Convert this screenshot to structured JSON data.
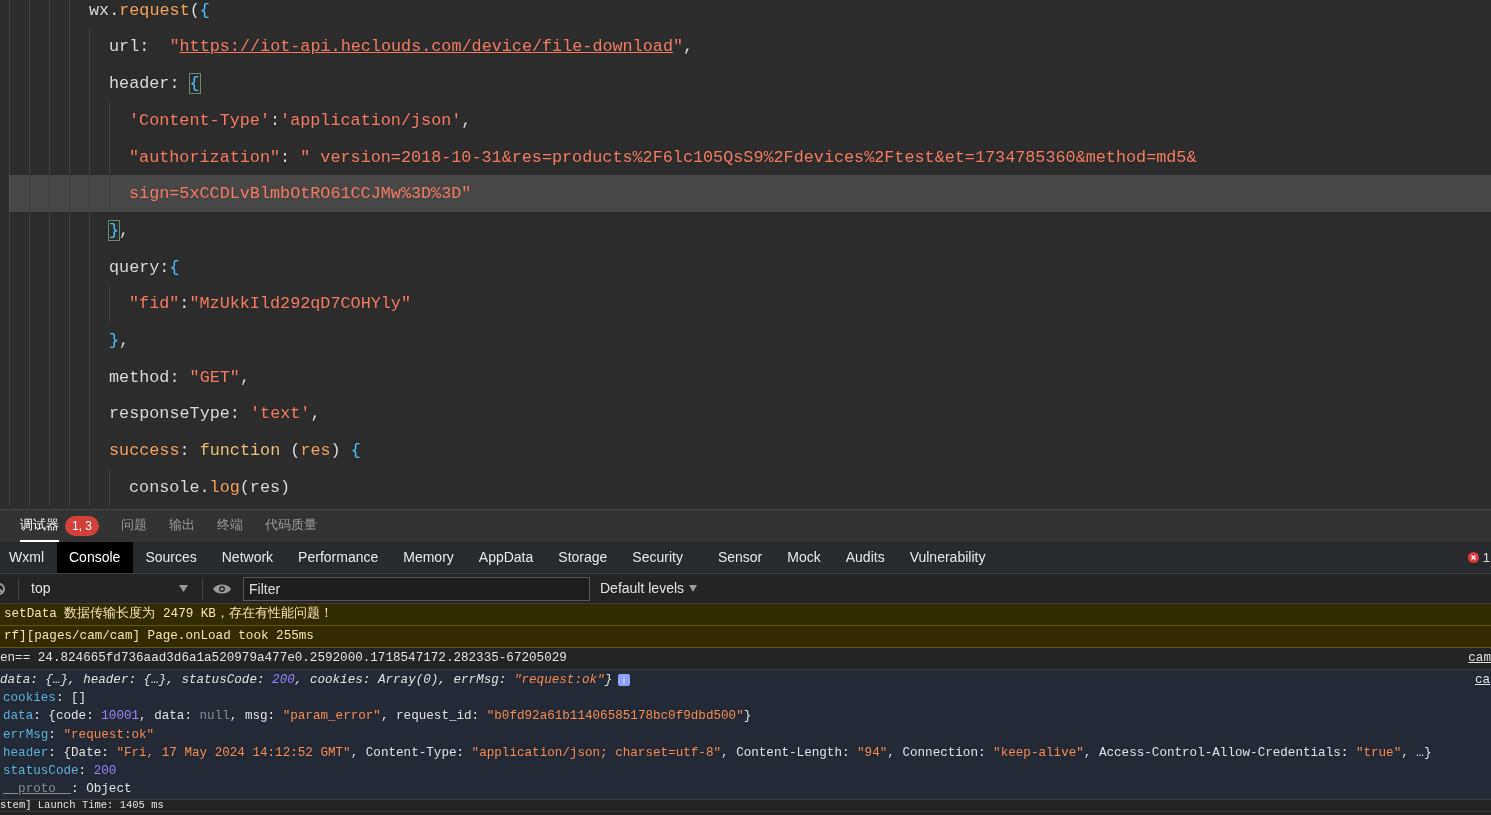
{
  "editor": {
    "lines": [
      {
        "highlighted": false,
        "tokens": [
          {
            "t": "wx.",
            "kind": "plain"
          },
          {
            "t": "request",
            "kind": "func"
          },
          {
            "t": "(",
            "kind": "plain"
          },
          {
            "t": "{",
            "kind": "bracket"
          }
        ],
        "children": [
          {
            "highlighted": false,
            "tokens": [
              {
                "t": "url:  ",
                "kind": "plain"
              },
              {
                "t": "\"",
                "kind": "str"
              },
              {
                "t": "https://iot-api.heclouds.com/device/file-download",
                "kind": "link"
              },
              {
                "t": "\"",
                "kind": "str"
              },
              {
                "t": ",",
                "kind": "plain"
              }
            ]
          },
          {
            "highlighted": false,
            "tokens": [
              {
                "t": "header: ",
                "kind": "plain"
              },
              {
                "t": "{",
                "kind": "match"
              }
            ],
            "children": [
              {
                "highlighted": false,
                "tokens": [
                  {
                    "t": "'Content-Type'",
                    "kind": "str"
                  },
                  {
                    "t": ":",
                    "kind": "plain"
                  },
                  {
                    "t": "'application/json'",
                    "kind": "str"
                  },
                  {
                    "t": ",",
                    "kind": "plain"
                  }
                ]
              },
              {
                "highlighted": false,
                "tokens": [
                  {
                    "t": "\"authorization\"",
                    "kind": "str"
                  },
                  {
                    "t": ": ",
                    "kind": "plain"
                  },
                  {
                    "t": "\" version=2018-10-31&res=products%2F6lc105QsS9%2Fdevices%2Ftest&et=1734785360&method=md5&",
                    "kind": "str"
                  }
                ]
              },
              {
                "highlighted": true,
                "tokens": [
                  {
                    "t": "sign=5xCCDLvBlmbOtRO61CCJMw%3D%3D\"",
                    "kind": "str"
                  }
                ]
              }
            ]
          },
          {
            "highlighted": false,
            "tokens": [
              {
                "t": "}",
                "kind": "match"
              },
              {
                "t": ",",
                "kind": "plain"
              }
            ]
          },
          {
            "highlighted": false,
            "tokens": [
              {
                "t": "query:",
                "kind": "plain"
              },
              {
                "t": "{",
                "kind": "bracket"
              }
            ],
            "children": [
              {
                "highlighted": false,
                "tokens": [
                  {
                    "t": "\"fid\"",
                    "kind": "str"
                  },
                  {
                    "t": ":",
                    "kind": "plain"
                  },
                  {
                    "t": "\"MzUkkIld292qD7COHYly\"",
                    "kind": "str"
                  }
                ]
              }
            ]
          },
          {
            "highlighted": false,
            "tokens": [
              {
                "t": "}",
                "kind": "bracket"
              },
              {
                "t": ",",
                "kind": "plain"
              }
            ]
          },
          {
            "highlighted": false,
            "tokens": [
              {
                "t": "method: ",
                "kind": "plain"
              },
              {
                "t": "\"GET\"",
                "kind": "str"
              },
              {
                "t": ",",
                "kind": "plain"
              }
            ]
          },
          {
            "highlighted": false,
            "tokens": [
              {
                "t": "responseType: ",
                "kind": "plain"
              },
              {
                "t": "'text'",
                "kind": "str"
              },
              {
                "t": ",",
                "kind": "plain"
              }
            ]
          },
          {
            "highlighted": false,
            "tokens": [
              {
                "t": "success",
                "kind": "func"
              },
              {
                "t": ": ",
                "kind": "plain"
              },
              {
                "t": "function",
                "kind": "keyword"
              },
              {
                "t": " (",
                "kind": "plain"
              },
              {
                "t": "res",
                "kind": "param"
              },
              {
                "t": ") ",
                "kind": "plain"
              },
              {
                "t": "{",
                "kind": "bracket"
              }
            ],
            "children": [
              {
                "highlighted": false,
                "tokens": [
                  {
                    "t": "console.",
                    "kind": "plain"
                  },
                  {
                    "t": "log",
                    "kind": "func"
                  },
                  {
                    "t": "(res)",
                    "kind": "plain"
                  }
                ]
              }
            ]
          }
        ]
      }
    ]
  },
  "bottom_panel": {
    "tabs": [
      {
        "label": "调试器",
        "selected": true,
        "badge": "1, 3"
      },
      {
        "label": "问题",
        "selected": false
      },
      {
        "label": "输出",
        "selected": false
      },
      {
        "label": "终端",
        "selected": false
      },
      {
        "label": "代码质量",
        "selected": false
      }
    ]
  },
  "devtools": {
    "tabs": [
      {
        "label": "Wxml",
        "selected": false
      },
      {
        "label": "Console",
        "selected": true
      },
      {
        "label": "Sources",
        "selected": false
      },
      {
        "label": "Network",
        "selected": false
      },
      {
        "label": "Performance",
        "selected": false
      },
      {
        "label": "Memory",
        "selected": false
      },
      {
        "label": "AppData",
        "selected": false
      },
      {
        "label": "Storage",
        "selected": false
      },
      {
        "label": "Security",
        "selected": false
      },
      {
        "label": "Sensor",
        "selected": false
      },
      {
        "label": "Mock",
        "selected": false
      },
      {
        "label": "Audits",
        "selected": false
      },
      {
        "label": "Vulnerability",
        "selected": false
      }
    ],
    "error_count": "1"
  },
  "console_toolbar": {
    "context": "top",
    "filter_placeholder": "Filter",
    "levels": "Default levels"
  },
  "console": {
    "messages": [
      {
        "kind": "warning",
        "text": "setData 数据传输长度为 2479 KB，存在有性能问题！"
      },
      {
        "kind": "warning",
        "text": "rf][pages/cam/cam] Page.onLoad took 255ms"
      },
      {
        "kind": "log",
        "text": "en== 24.824665fd736aad3d6a1a520979a477e0.2592000.1718547172.282335-67205029",
        "link": "cam"
      },
      {
        "kind": "object",
        "link": "ca",
        "summary": [
          {
            "t": "data: {…}, header: {…}, statusCode: ",
            "kind": "plain"
          },
          {
            "t": "200",
            "kind": "num"
          },
          {
            "t": ", cookies: Array(0), errMsg: ",
            "kind": "plain"
          },
          {
            "t": "\"request:ok\"",
            "kind": "str"
          },
          {
            "t": "}",
            "kind": "plain"
          }
        ],
        "lines": [
          {
            "tokens": [
              {
                "t": "cookies",
                "kind": "key"
              },
              {
                "t": ": []",
                "kind": "plain"
              }
            ]
          },
          {
            "tokens": [
              {
                "t": "data",
                "kind": "key"
              },
              {
                "t": ": {code: ",
                "kind": "plain"
              },
              {
                "t": "10001",
                "kind": "num"
              },
              {
                "t": ", data: ",
                "kind": "plain"
              },
              {
                "t": "null",
                "kind": "null"
              },
              {
                "t": ", msg: ",
                "kind": "plain"
              },
              {
                "t": "\"param_error\"",
                "kind": "str"
              },
              {
                "t": ", request_id: ",
                "kind": "plain"
              },
              {
                "t": "\"b0fd92a61b11406585178bc0f9dbd500\"",
                "kind": "str"
              },
              {
                "t": "}",
                "kind": "plain"
              }
            ]
          },
          {
            "tokens": [
              {
                "t": "errMsg",
                "kind": "key"
              },
              {
                "t": ": ",
                "kind": "plain"
              },
              {
                "t": "\"request:ok\"",
                "kind": "str"
              }
            ]
          },
          {
            "tokens": [
              {
                "t": "header",
                "kind": "key"
              },
              {
                "t": ": {Date: ",
                "kind": "plain"
              },
              {
                "t": "\"Fri, 17 May 2024 14:12:52 GMT\"",
                "kind": "str"
              },
              {
                "t": ", Content-Type: ",
                "kind": "plain"
              },
              {
                "t": "\"application/json; charset=utf-8\"",
                "kind": "str"
              },
              {
                "t": ", Content-Length: ",
                "kind": "plain"
              },
              {
                "t": "\"94\"",
                "kind": "str"
              },
              {
                "t": ", Connection: ",
                "kind": "plain"
              },
              {
                "t": "\"keep-alive\"",
                "kind": "str"
              },
              {
                "t": ", Access-Control-Allow-Credentials: ",
                "kind": "plain"
              },
              {
                "t": "\"true\"",
                "kind": "str"
              },
              {
                "t": ", …}",
                "kind": "plain"
              }
            ]
          },
          {
            "tokens": [
              {
                "t": "statusCode",
                "kind": "key"
              },
              {
                "t": ": ",
                "kind": "plain"
              },
              {
                "t": "200",
                "kind": "num"
              }
            ]
          },
          {
            "tokens": [
              {
                "t": "__proto__",
                "kind": "proto"
              },
              {
                "t": ": Object",
                "kind": "plain"
              }
            ]
          }
        ]
      },
      {
        "kind": "log",
        "text": "stem] Launch Time: 1405 ms"
      }
    ]
  }
}
